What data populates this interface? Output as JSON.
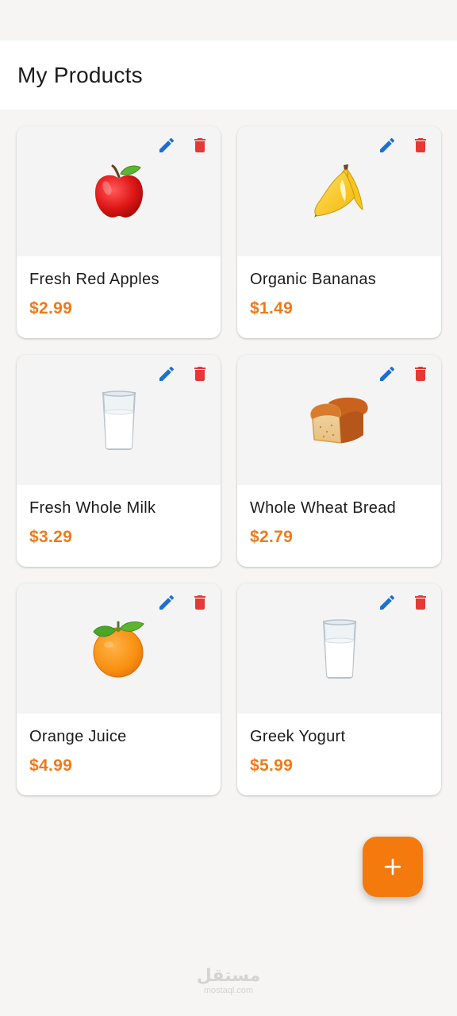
{
  "appbar": {
    "title": "My Products"
  },
  "products": [
    {
      "name": "Fresh Red Apples",
      "price": "$2.99",
      "icon": "apple-icon"
    },
    {
      "name": "Organic Bananas",
      "price": "$1.49",
      "icon": "banana-icon"
    },
    {
      "name": "Fresh Whole Milk",
      "price": "$3.29",
      "icon": "milk-glass-icon"
    },
    {
      "name": "Whole Wheat Bread",
      "price": "$2.79",
      "icon": "bread-icon"
    },
    {
      "name": "Orange Juice",
      "price": "$4.99",
      "icon": "orange-icon"
    },
    {
      "name": "Greek Yogurt",
      "price": "$5.99",
      "icon": "milk-glass-icon"
    }
  ],
  "actions": {
    "edit_icon": "pencil-icon",
    "delete_icon": "trash-icon"
  },
  "fab": {
    "icon": "plus-icon"
  },
  "watermark": {
    "arabic": "مستقل",
    "latin": "mostaql.com"
  },
  "colors": {
    "accent": "#f47a0e",
    "price": "#ee7a1b",
    "edit": "#1e6fd0",
    "delete": "#e53935",
    "background": "#f6f5f4",
    "image_bg": "#f4f4f4"
  }
}
